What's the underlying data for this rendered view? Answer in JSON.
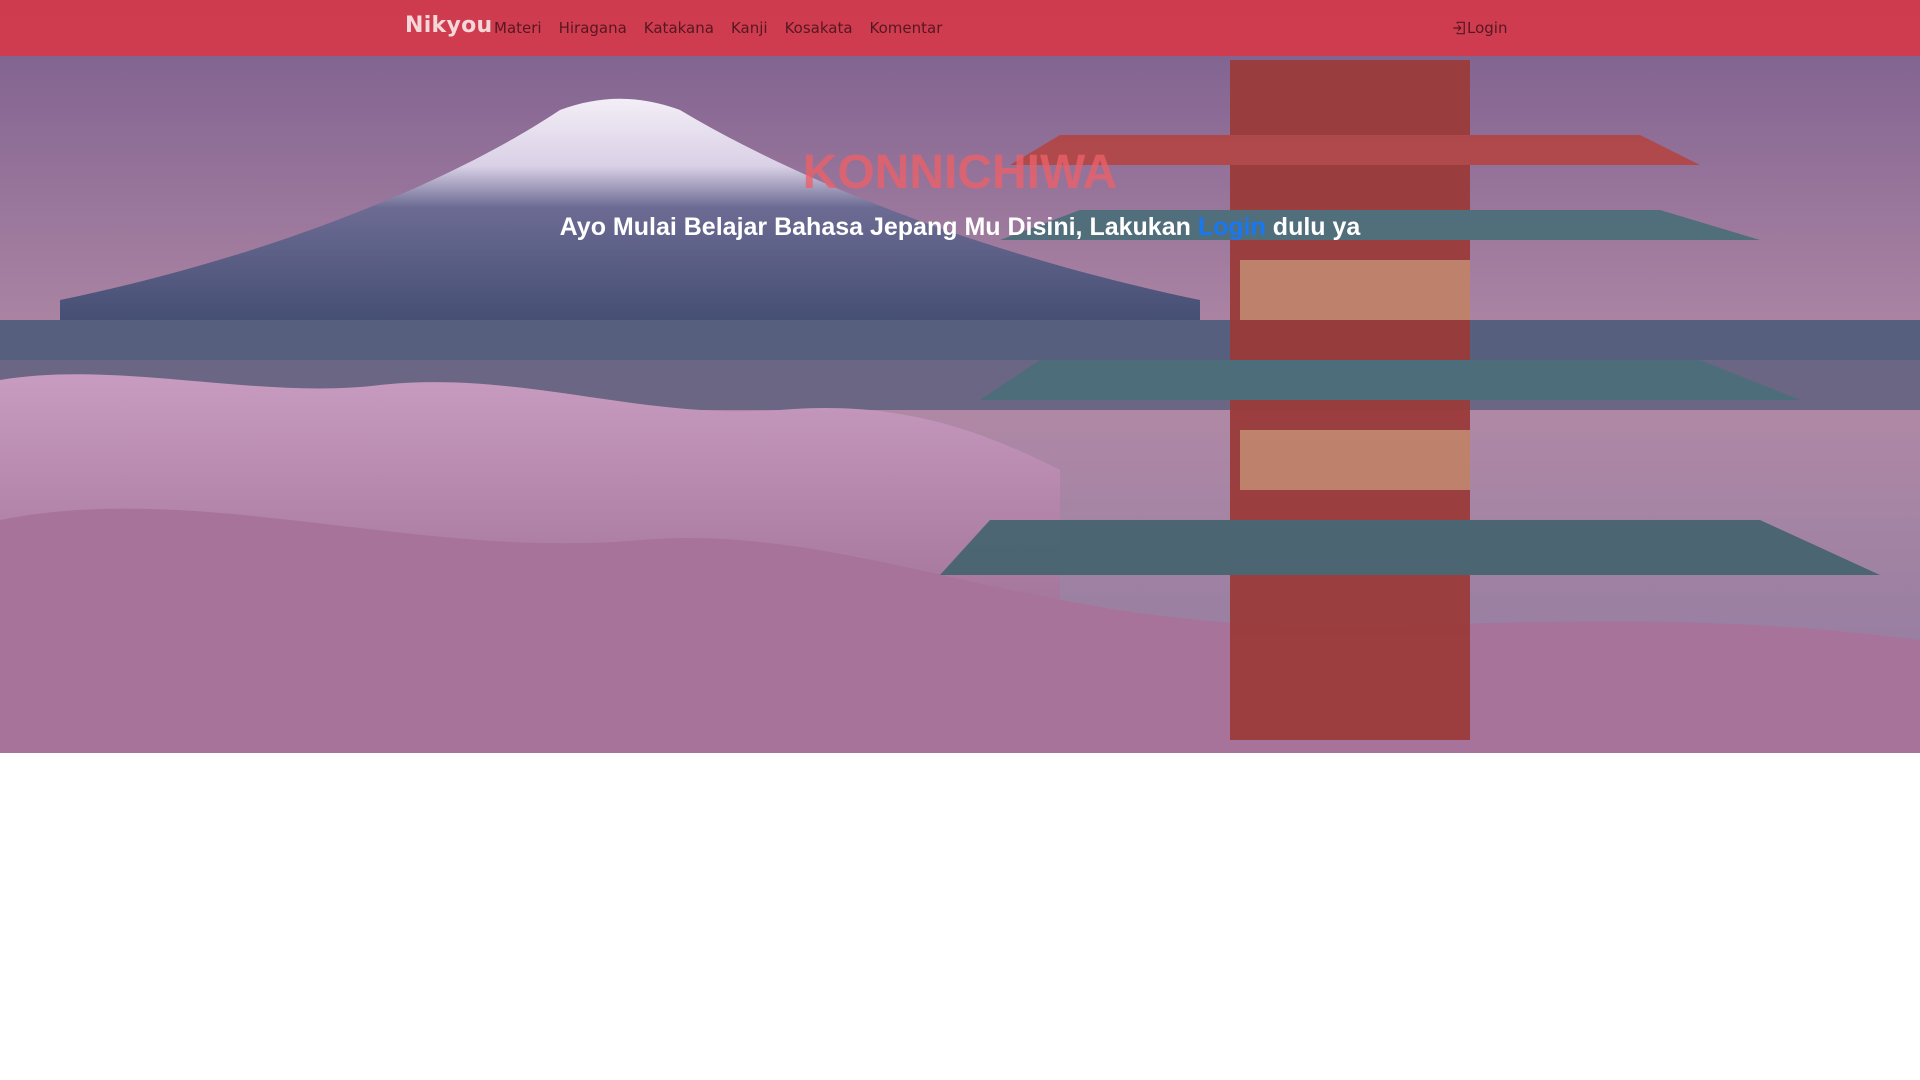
{
  "navbar": {
    "brand": "Nikyou",
    "links": [
      "Materi",
      "Hiragana",
      "Katakana",
      "Kanji",
      "Kosakata",
      "Komentar"
    ],
    "login_label": "Login",
    "login_icon": "login-icon",
    "background_color": "#dc3545"
  },
  "hero": {
    "title": "KONNICHIWA",
    "subtitle_before": "Ayo Mulai Belajar Bahasa Jepang Mu Disini, Lakukan ",
    "subtitle_link": "Login",
    "subtitle_after": " dulu ya",
    "title_color": "#ec6068",
    "link_color": "#1877f2"
  }
}
